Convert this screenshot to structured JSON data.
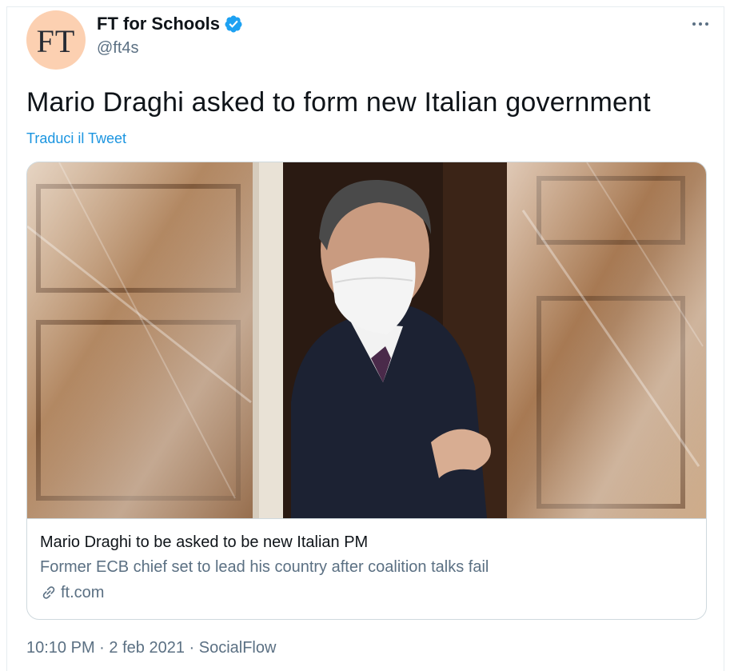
{
  "author": {
    "avatar_text": "FT",
    "name": "FT for Schools",
    "handle": "@ft4s",
    "verified": true
  },
  "tweet": {
    "text": "Mario Draghi asked to form new Italian government",
    "translate_label": "Traduci il Tweet"
  },
  "card": {
    "title": "Mario Draghi to be asked to be new Italian PM",
    "description": "Former ECB chief set to lead his country after coalition talks fail",
    "domain": "ft.com",
    "link_icon": "link-icon",
    "image_description": "photo-man-in-mask-doorway"
  },
  "meta": {
    "time": "10:10 PM",
    "separator": "·",
    "date": "2 feb 2021",
    "source": "SocialFlow"
  },
  "colors": {
    "avatar_bg": "#fcd0b1",
    "link_blue": "#1b95e0",
    "muted": "#5b7083",
    "verified": "#1da1f2",
    "border": "#cfd9de"
  }
}
